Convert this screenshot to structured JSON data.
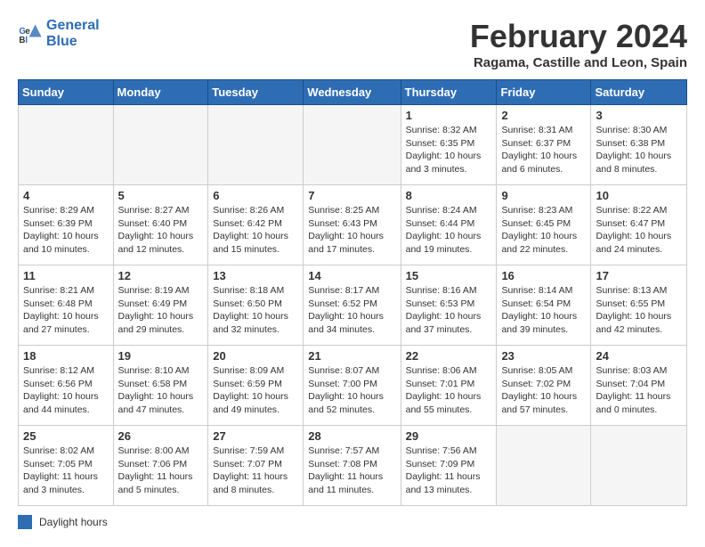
{
  "logo": {
    "line1": "General",
    "line2": "Blue"
  },
  "title": "February 2024",
  "location": "Ragama, Castille and Leon, Spain",
  "days_of_week": [
    "Sunday",
    "Monday",
    "Tuesday",
    "Wednesday",
    "Thursday",
    "Friday",
    "Saturday"
  ],
  "weeks": [
    [
      {
        "day": "",
        "info": ""
      },
      {
        "day": "",
        "info": ""
      },
      {
        "day": "",
        "info": ""
      },
      {
        "day": "",
        "info": ""
      },
      {
        "day": "1",
        "info": "Sunrise: 8:32 AM\nSunset: 6:35 PM\nDaylight: 10 hours and 3 minutes."
      },
      {
        "day": "2",
        "info": "Sunrise: 8:31 AM\nSunset: 6:37 PM\nDaylight: 10 hours and 6 minutes."
      },
      {
        "day": "3",
        "info": "Sunrise: 8:30 AM\nSunset: 6:38 PM\nDaylight: 10 hours and 8 minutes."
      }
    ],
    [
      {
        "day": "4",
        "info": "Sunrise: 8:29 AM\nSunset: 6:39 PM\nDaylight: 10 hours and 10 minutes."
      },
      {
        "day": "5",
        "info": "Sunrise: 8:27 AM\nSunset: 6:40 PM\nDaylight: 10 hours and 12 minutes."
      },
      {
        "day": "6",
        "info": "Sunrise: 8:26 AM\nSunset: 6:42 PM\nDaylight: 10 hours and 15 minutes."
      },
      {
        "day": "7",
        "info": "Sunrise: 8:25 AM\nSunset: 6:43 PM\nDaylight: 10 hours and 17 minutes."
      },
      {
        "day": "8",
        "info": "Sunrise: 8:24 AM\nSunset: 6:44 PM\nDaylight: 10 hours and 19 minutes."
      },
      {
        "day": "9",
        "info": "Sunrise: 8:23 AM\nSunset: 6:45 PM\nDaylight: 10 hours and 22 minutes."
      },
      {
        "day": "10",
        "info": "Sunrise: 8:22 AM\nSunset: 6:47 PM\nDaylight: 10 hours and 24 minutes."
      }
    ],
    [
      {
        "day": "11",
        "info": "Sunrise: 8:21 AM\nSunset: 6:48 PM\nDaylight: 10 hours and 27 minutes."
      },
      {
        "day": "12",
        "info": "Sunrise: 8:19 AM\nSunset: 6:49 PM\nDaylight: 10 hours and 29 minutes."
      },
      {
        "day": "13",
        "info": "Sunrise: 8:18 AM\nSunset: 6:50 PM\nDaylight: 10 hours and 32 minutes."
      },
      {
        "day": "14",
        "info": "Sunrise: 8:17 AM\nSunset: 6:52 PM\nDaylight: 10 hours and 34 minutes."
      },
      {
        "day": "15",
        "info": "Sunrise: 8:16 AM\nSunset: 6:53 PM\nDaylight: 10 hours and 37 minutes."
      },
      {
        "day": "16",
        "info": "Sunrise: 8:14 AM\nSunset: 6:54 PM\nDaylight: 10 hours and 39 minutes."
      },
      {
        "day": "17",
        "info": "Sunrise: 8:13 AM\nSunset: 6:55 PM\nDaylight: 10 hours and 42 minutes."
      }
    ],
    [
      {
        "day": "18",
        "info": "Sunrise: 8:12 AM\nSunset: 6:56 PM\nDaylight: 10 hours and 44 minutes."
      },
      {
        "day": "19",
        "info": "Sunrise: 8:10 AM\nSunset: 6:58 PM\nDaylight: 10 hours and 47 minutes."
      },
      {
        "day": "20",
        "info": "Sunrise: 8:09 AM\nSunset: 6:59 PM\nDaylight: 10 hours and 49 minutes."
      },
      {
        "day": "21",
        "info": "Sunrise: 8:07 AM\nSunset: 7:00 PM\nDaylight: 10 hours and 52 minutes."
      },
      {
        "day": "22",
        "info": "Sunrise: 8:06 AM\nSunset: 7:01 PM\nDaylight: 10 hours and 55 minutes."
      },
      {
        "day": "23",
        "info": "Sunrise: 8:05 AM\nSunset: 7:02 PM\nDaylight: 10 hours and 57 minutes."
      },
      {
        "day": "24",
        "info": "Sunrise: 8:03 AM\nSunset: 7:04 PM\nDaylight: 11 hours and 0 minutes."
      }
    ],
    [
      {
        "day": "25",
        "info": "Sunrise: 8:02 AM\nSunset: 7:05 PM\nDaylight: 11 hours and 3 minutes."
      },
      {
        "day": "26",
        "info": "Sunrise: 8:00 AM\nSunset: 7:06 PM\nDaylight: 11 hours and 5 minutes."
      },
      {
        "day": "27",
        "info": "Sunrise: 7:59 AM\nSunset: 7:07 PM\nDaylight: 11 hours and 8 minutes."
      },
      {
        "day": "28",
        "info": "Sunrise: 7:57 AM\nSunset: 7:08 PM\nDaylight: 11 hours and 11 minutes."
      },
      {
        "day": "29",
        "info": "Sunrise: 7:56 AM\nSunset: 7:09 PM\nDaylight: 11 hours and 13 minutes."
      },
      {
        "day": "",
        "info": ""
      },
      {
        "day": "",
        "info": ""
      }
    ]
  ],
  "legend": {
    "label": "Daylight hours"
  }
}
